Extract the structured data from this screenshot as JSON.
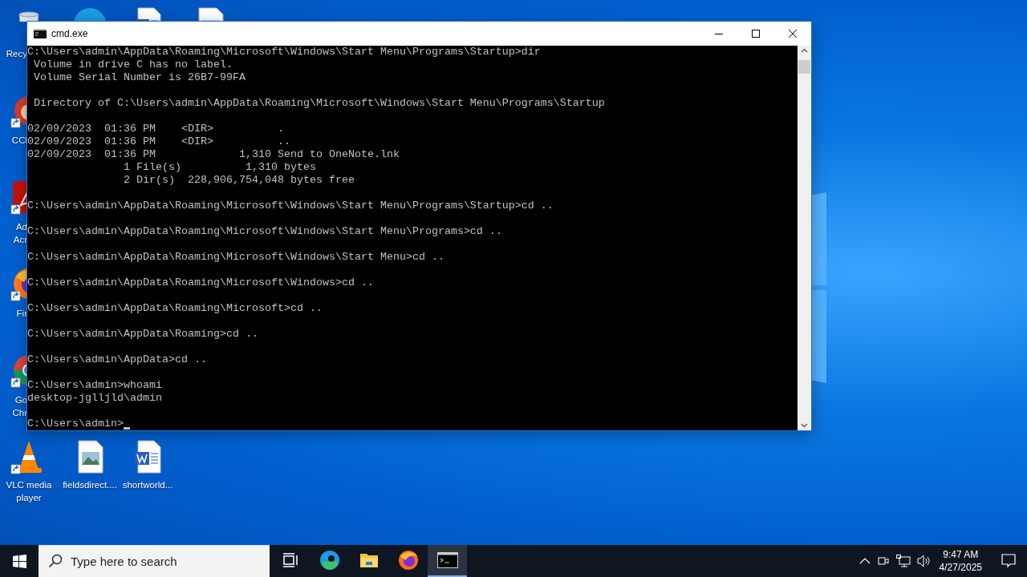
{
  "desktop": {
    "icons": [
      {
        "kind": "recycle-bin",
        "label": "Recy",
        "cut": true
      },
      {
        "kind": "edge"
      },
      {
        "kind": "word"
      },
      {
        "kind": "document"
      },
      {
        "kind": "ccleaner",
        "label": "CCl",
        "cut": true,
        "shortcut": true
      },
      {
        "kind": "acrobat",
        "label": "Ad\nAcr",
        "cut": true,
        "shortcut": true
      },
      {
        "kind": "firefox",
        "label": "Fir",
        "cut": true,
        "shortcut": true
      },
      {
        "kind": "chrome",
        "label": "Go\nChr",
        "cut": true,
        "shortcut": true
      },
      {
        "kind": "vlc",
        "label": "VLC media player",
        "cut": false,
        "shortcut": true
      },
      {
        "kind": "image",
        "label": "fieldsdirect....",
        "cut": false,
        "shortcut": false
      },
      {
        "kind": "word",
        "label": "shortworld...",
        "cut": false,
        "shortcut": false
      }
    ]
  },
  "window": {
    "title": "cmd.exe",
    "lines": [
      {
        "kind": "text",
        "text": "C:\\Users\\admin\\AppData\\Roaming\\Microsoft\\Windows\\Start Menu\\Programs\\Startup>dir"
      },
      {
        "kind": "text",
        "text": " Volume in drive C has no label."
      },
      {
        "kind": "text",
        "text": " Volume Serial Number is 26B7-99FA"
      },
      {
        "kind": "blank"
      },
      {
        "kind": "text",
        "text": " Directory of C:\\Users\\admin\\AppData\\Roaming\\Microsoft\\Windows\\Start Menu\\Programs\\Startup"
      },
      {
        "kind": "blank"
      },
      {
        "kind": "text",
        "text": "02/09/2023  01:36 PM    <DIR>          ."
      },
      {
        "kind": "text",
        "text": "02/09/2023  01:36 PM    <DIR>          .."
      },
      {
        "kind": "text",
        "text": "02/09/2023  01:36 PM             1,310 Send to OneNote.lnk"
      },
      {
        "kind": "text",
        "text": "               1 File(s)          1,310 bytes"
      },
      {
        "kind": "text",
        "text": "               2 Dir(s)  228,906,754,048 bytes free"
      },
      {
        "kind": "blank"
      },
      {
        "kind": "text",
        "text": "C:\\Users\\admin\\AppData\\Roaming\\Microsoft\\Windows\\Start Menu\\Programs\\Startup>cd .."
      },
      {
        "kind": "blank"
      },
      {
        "kind": "text",
        "text": "C:\\Users\\admin\\AppData\\Roaming\\Microsoft\\Windows\\Start Menu\\Programs>cd .."
      },
      {
        "kind": "blank"
      },
      {
        "kind": "text",
        "text": "C:\\Users\\admin\\AppData\\Roaming\\Microsoft\\Windows\\Start Menu>cd .."
      },
      {
        "kind": "blank"
      },
      {
        "kind": "text",
        "text": "C:\\Users\\admin\\AppData\\Roaming\\Microsoft\\Windows>cd .."
      },
      {
        "kind": "blank"
      },
      {
        "kind": "text",
        "text": "C:\\Users\\admin\\AppData\\Roaming\\Microsoft>cd .."
      },
      {
        "kind": "blank"
      },
      {
        "kind": "text",
        "text": "C:\\Users\\admin\\AppData\\Roaming>cd .."
      },
      {
        "kind": "blank"
      },
      {
        "kind": "text",
        "text": "C:\\Users\\admin\\AppData>cd .."
      },
      {
        "kind": "blank"
      },
      {
        "kind": "text",
        "text": "C:\\Users\\admin>whoami"
      },
      {
        "kind": "text",
        "text": "desktop-jglljld\\admin"
      },
      {
        "kind": "blank"
      },
      {
        "kind": "prompt",
        "text": "C:\\Users\\admin>"
      }
    ]
  },
  "taskbar": {
    "search": {
      "placeholder": "Type here to search"
    },
    "apps": [
      {
        "kind": "task-view",
        "selected": false
      },
      {
        "kind": "edge",
        "selected": false
      },
      {
        "kind": "folder",
        "selected": false
      },
      {
        "kind": "firefox",
        "selected": false
      },
      {
        "kind": "terminal",
        "selected": true
      }
    ],
    "clock": {
      "time": "9:47 AM",
      "date": "4/27/2025"
    }
  }
}
